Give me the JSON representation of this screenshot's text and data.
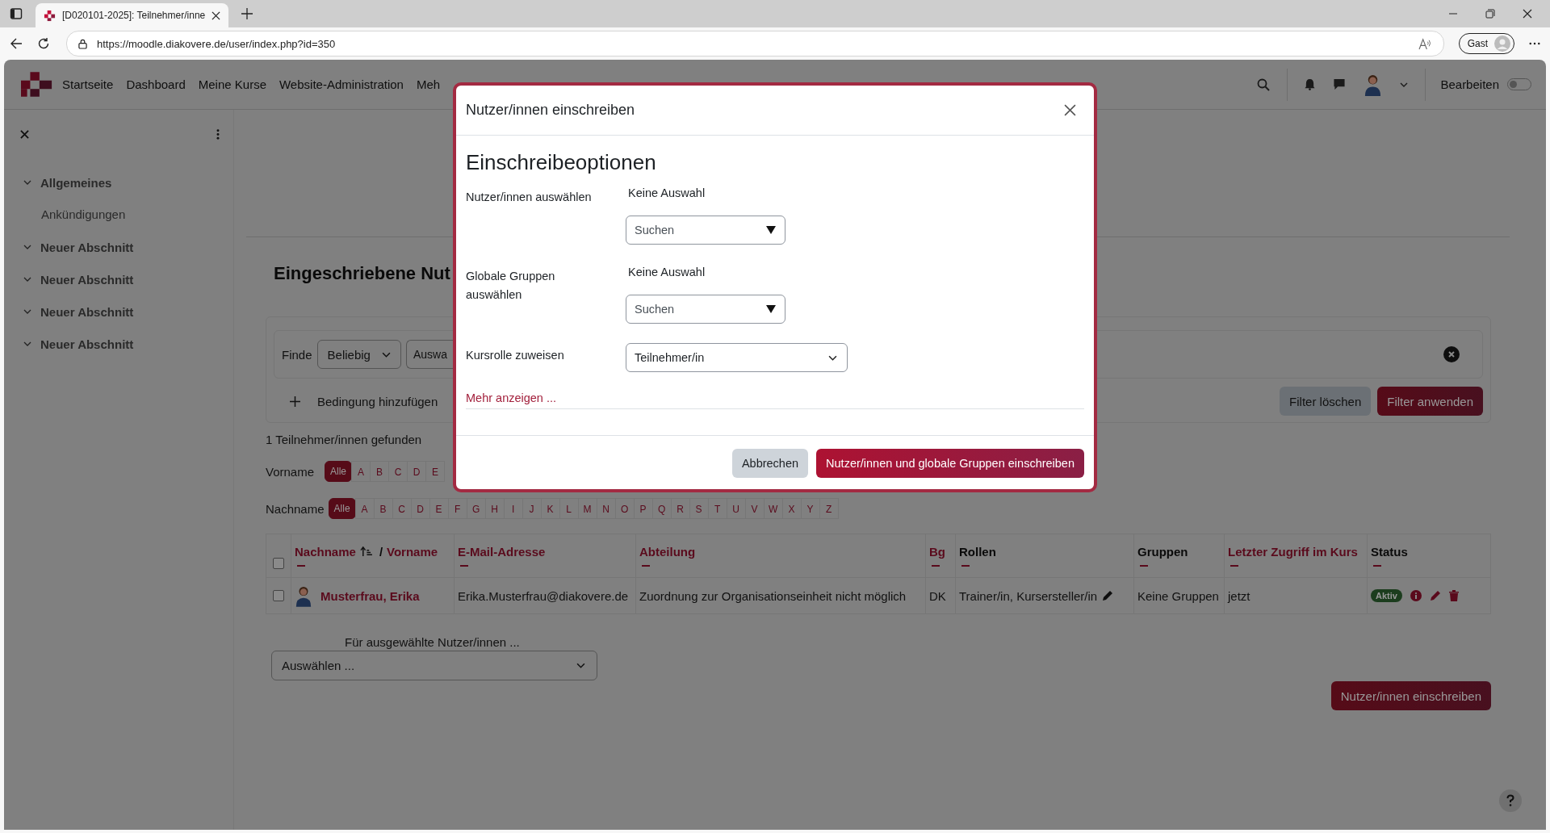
{
  "browser": {
    "tab_title": "[D020101-2025]: Teilnehmer/inne",
    "url": "https://moodle.diakovere.de/user/index.php?id=350",
    "profile": "Gast"
  },
  "nav": {
    "items": [
      "Startseite",
      "Dashboard",
      "Meine Kurse",
      "Website-Administration",
      "Meh"
    ],
    "edit_label": "Bearbeiten",
    "edit_on": false
  },
  "sidebar": {
    "items": [
      {
        "label": "Allgemeines",
        "expanded": true,
        "children": [
          {
            "label": "Ankündigungen"
          }
        ]
      },
      {
        "label": "Neuer Abschnitt",
        "expanded": true
      },
      {
        "label": "Neuer Abschnitt",
        "expanded": true
      },
      {
        "label": "Neuer Abschnitt",
        "expanded": true
      },
      {
        "label": "Neuer Abschnitt",
        "expanded": true
      }
    ]
  },
  "page": {
    "heading": "Eingeschriebene Nut",
    "filter": {
      "match_label": "Finde",
      "match_value": "Beliebig",
      "type_value": "Auswa",
      "add_condition": "Bedingung hinzufügen",
      "clear": "Filter löschen",
      "apply": "Filter anwenden"
    },
    "result_count": "1 Teilnehmer/innen gefunden",
    "initials": [
      {
        "label": "Vorname",
        "letters": [
          {
            "text": "Alle",
            "selected": true
          },
          {
            "text": "A",
            "selected": false
          },
          {
            "text": "B",
            "selected": false
          },
          {
            "text": "C",
            "selected": false
          },
          {
            "text": "D",
            "selected": false
          },
          {
            "text": "E",
            "selected": false
          }
        ]
      },
      {
        "label": "Nachname",
        "letters": [
          {
            "text": "Alle",
            "selected": true
          },
          {
            "text": "A",
            "selected": false
          },
          {
            "text": "B",
            "selected": false
          },
          {
            "text": "C",
            "selected": false
          },
          {
            "text": "D",
            "selected": false
          },
          {
            "text": "E",
            "selected": false
          },
          {
            "text": "F",
            "selected": false
          },
          {
            "text": "G",
            "selected": false
          },
          {
            "text": "H",
            "selected": false
          },
          {
            "text": "I",
            "selected": false
          },
          {
            "text": "J",
            "selected": false
          },
          {
            "text": "K",
            "selected": false
          },
          {
            "text": "L",
            "selected": false
          },
          {
            "text": "M",
            "selected": false
          },
          {
            "text": "N",
            "selected": false
          },
          {
            "text": "O",
            "selected": false
          },
          {
            "text": "P",
            "selected": false
          },
          {
            "text": "Q",
            "selected": false
          },
          {
            "text": "R",
            "selected": false
          },
          {
            "text": "S",
            "selected": false
          },
          {
            "text": "T",
            "selected": false
          },
          {
            "text": "U",
            "selected": false
          },
          {
            "text": "V",
            "selected": false
          },
          {
            "text": "W",
            "selected": false
          },
          {
            "text": "X",
            "selected": false
          },
          {
            "text": "Y",
            "selected": false
          },
          {
            "text": "Z",
            "selected": false
          }
        ]
      }
    ],
    "table": {
      "select_all_checked": false,
      "columns": [
        {
          "label": "Nachname",
          "link": true,
          "sorted": true,
          "separator": "/",
          "second_label": "Vorname"
        },
        {
          "label": "E-Mail-Adresse",
          "link": true
        },
        {
          "label": "Abteilung",
          "link": true
        },
        {
          "label": "Bg",
          "link": true
        },
        {
          "label": "Rollen",
          "link": false
        },
        {
          "label": "Gruppen",
          "link": false
        },
        {
          "label": "Letzter Zugriff im Kurs",
          "link": true
        },
        {
          "label": "Status",
          "link": false
        }
      ],
      "rows": [
        {
          "checked": false,
          "name": "Musterfrau, Erika",
          "email": "Erika.Musterfrau@diakovere.de",
          "department": "Zuordnung zur Organisationseinheit nicht möglich",
          "bg": "DK",
          "roles": "Trainer/in, Kursersteller/in",
          "groups": "Keine Gruppen",
          "last_access": "jetzt",
          "status": "Aktiv"
        }
      ]
    },
    "bulk": {
      "label": "Für ausgewählte Nutzer/innen ...",
      "value": "Auswählen ..."
    },
    "enrol_button": "Nutzer/innen einschreiben"
  },
  "modal": {
    "title": "Nutzer/innen einschreiben",
    "section": "Einschreibeoptionen",
    "fields": [
      {
        "kind": "autocomplete",
        "label": "Nutzer/innen auswählen",
        "selection": "Keine Auswahl",
        "placeholder": "Suchen"
      },
      {
        "kind": "autocomplete",
        "label": "Globale Gruppen auswählen",
        "selection": "Keine Auswahl",
        "placeholder": "Suchen"
      },
      {
        "kind": "select",
        "label": "Kursrolle zuweisen",
        "value": "Teilnehmer/in"
      }
    ],
    "more_link": "Mehr anzeigen ...",
    "cancel": "Abbrechen",
    "submit": "Nutzer/innen und globale Gruppen einschreiben"
  }
}
